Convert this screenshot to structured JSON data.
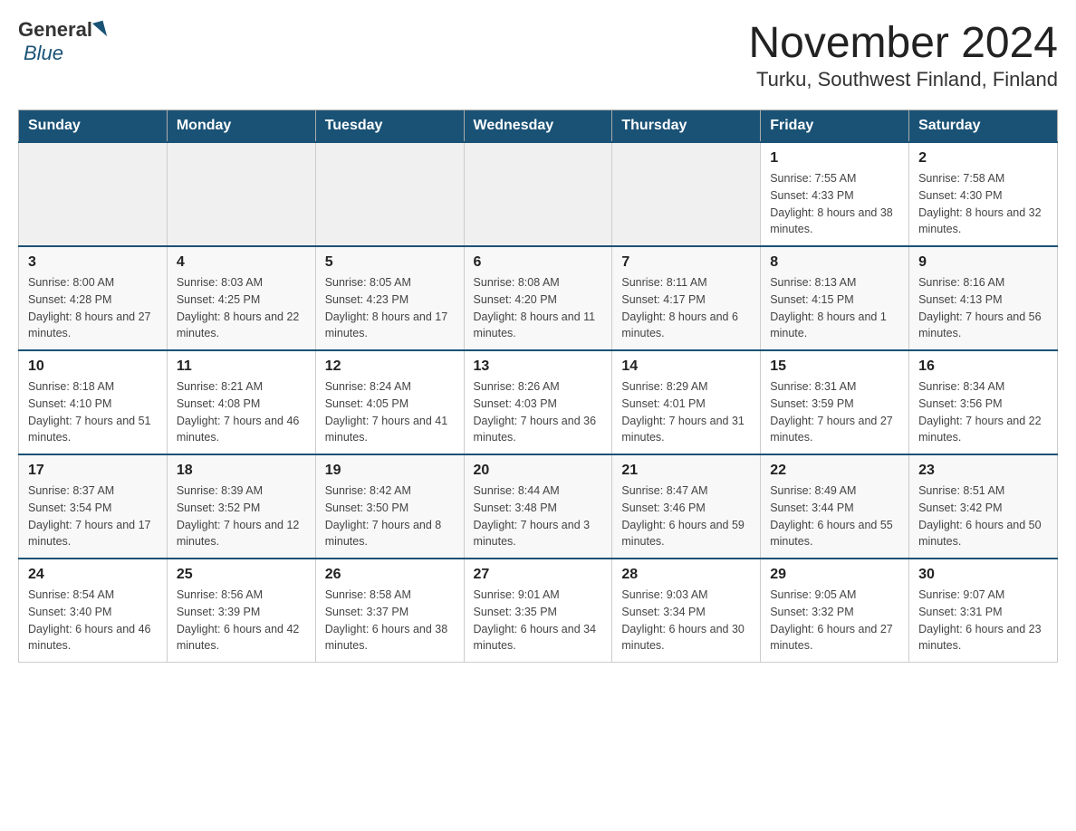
{
  "header": {
    "logo_general": "General",
    "logo_blue": "Blue",
    "title": "November 2024",
    "subtitle": "Turku, Southwest Finland, Finland"
  },
  "weekdays": [
    "Sunday",
    "Monday",
    "Tuesday",
    "Wednesday",
    "Thursday",
    "Friday",
    "Saturday"
  ],
  "weeks": [
    [
      {
        "day": "",
        "sunrise": "",
        "sunset": "",
        "daylight": ""
      },
      {
        "day": "",
        "sunrise": "",
        "sunset": "",
        "daylight": ""
      },
      {
        "day": "",
        "sunrise": "",
        "sunset": "",
        "daylight": ""
      },
      {
        "day": "",
        "sunrise": "",
        "sunset": "",
        "daylight": ""
      },
      {
        "day": "",
        "sunrise": "",
        "sunset": "",
        "daylight": ""
      },
      {
        "day": "1",
        "sunrise": "Sunrise: 7:55 AM",
        "sunset": "Sunset: 4:33 PM",
        "daylight": "Daylight: 8 hours and 38 minutes."
      },
      {
        "day": "2",
        "sunrise": "Sunrise: 7:58 AM",
        "sunset": "Sunset: 4:30 PM",
        "daylight": "Daylight: 8 hours and 32 minutes."
      }
    ],
    [
      {
        "day": "3",
        "sunrise": "Sunrise: 8:00 AM",
        "sunset": "Sunset: 4:28 PM",
        "daylight": "Daylight: 8 hours and 27 minutes."
      },
      {
        "day": "4",
        "sunrise": "Sunrise: 8:03 AM",
        "sunset": "Sunset: 4:25 PM",
        "daylight": "Daylight: 8 hours and 22 minutes."
      },
      {
        "day": "5",
        "sunrise": "Sunrise: 8:05 AM",
        "sunset": "Sunset: 4:23 PM",
        "daylight": "Daylight: 8 hours and 17 minutes."
      },
      {
        "day": "6",
        "sunrise": "Sunrise: 8:08 AM",
        "sunset": "Sunset: 4:20 PM",
        "daylight": "Daylight: 8 hours and 11 minutes."
      },
      {
        "day": "7",
        "sunrise": "Sunrise: 8:11 AM",
        "sunset": "Sunset: 4:17 PM",
        "daylight": "Daylight: 8 hours and 6 minutes."
      },
      {
        "day": "8",
        "sunrise": "Sunrise: 8:13 AM",
        "sunset": "Sunset: 4:15 PM",
        "daylight": "Daylight: 8 hours and 1 minute."
      },
      {
        "day": "9",
        "sunrise": "Sunrise: 8:16 AM",
        "sunset": "Sunset: 4:13 PM",
        "daylight": "Daylight: 7 hours and 56 minutes."
      }
    ],
    [
      {
        "day": "10",
        "sunrise": "Sunrise: 8:18 AM",
        "sunset": "Sunset: 4:10 PM",
        "daylight": "Daylight: 7 hours and 51 minutes."
      },
      {
        "day": "11",
        "sunrise": "Sunrise: 8:21 AM",
        "sunset": "Sunset: 4:08 PM",
        "daylight": "Daylight: 7 hours and 46 minutes."
      },
      {
        "day": "12",
        "sunrise": "Sunrise: 8:24 AM",
        "sunset": "Sunset: 4:05 PM",
        "daylight": "Daylight: 7 hours and 41 minutes."
      },
      {
        "day": "13",
        "sunrise": "Sunrise: 8:26 AM",
        "sunset": "Sunset: 4:03 PM",
        "daylight": "Daylight: 7 hours and 36 minutes."
      },
      {
        "day": "14",
        "sunrise": "Sunrise: 8:29 AM",
        "sunset": "Sunset: 4:01 PM",
        "daylight": "Daylight: 7 hours and 31 minutes."
      },
      {
        "day": "15",
        "sunrise": "Sunrise: 8:31 AM",
        "sunset": "Sunset: 3:59 PM",
        "daylight": "Daylight: 7 hours and 27 minutes."
      },
      {
        "day": "16",
        "sunrise": "Sunrise: 8:34 AM",
        "sunset": "Sunset: 3:56 PM",
        "daylight": "Daylight: 7 hours and 22 minutes."
      }
    ],
    [
      {
        "day": "17",
        "sunrise": "Sunrise: 8:37 AM",
        "sunset": "Sunset: 3:54 PM",
        "daylight": "Daylight: 7 hours and 17 minutes."
      },
      {
        "day": "18",
        "sunrise": "Sunrise: 8:39 AM",
        "sunset": "Sunset: 3:52 PM",
        "daylight": "Daylight: 7 hours and 12 minutes."
      },
      {
        "day": "19",
        "sunrise": "Sunrise: 8:42 AM",
        "sunset": "Sunset: 3:50 PM",
        "daylight": "Daylight: 7 hours and 8 minutes."
      },
      {
        "day": "20",
        "sunrise": "Sunrise: 8:44 AM",
        "sunset": "Sunset: 3:48 PM",
        "daylight": "Daylight: 7 hours and 3 minutes."
      },
      {
        "day": "21",
        "sunrise": "Sunrise: 8:47 AM",
        "sunset": "Sunset: 3:46 PM",
        "daylight": "Daylight: 6 hours and 59 minutes."
      },
      {
        "day": "22",
        "sunrise": "Sunrise: 8:49 AM",
        "sunset": "Sunset: 3:44 PM",
        "daylight": "Daylight: 6 hours and 55 minutes."
      },
      {
        "day": "23",
        "sunrise": "Sunrise: 8:51 AM",
        "sunset": "Sunset: 3:42 PM",
        "daylight": "Daylight: 6 hours and 50 minutes."
      }
    ],
    [
      {
        "day": "24",
        "sunrise": "Sunrise: 8:54 AM",
        "sunset": "Sunset: 3:40 PM",
        "daylight": "Daylight: 6 hours and 46 minutes."
      },
      {
        "day": "25",
        "sunrise": "Sunrise: 8:56 AM",
        "sunset": "Sunset: 3:39 PM",
        "daylight": "Daylight: 6 hours and 42 minutes."
      },
      {
        "day": "26",
        "sunrise": "Sunrise: 8:58 AM",
        "sunset": "Sunset: 3:37 PM",
        "daylight": "Daylight: 6 hours and 38 minutes."
      },
      {
        "day": "27",
        "sunrise": "Sunrise: 9:01 AM",
        "sunset": "Sunset: 3:35 PM",
        "daylight": "Daylight: 6 hours and 34 minutes."
      },
      {
        "day": "28",
        "sunrise": "Sunrise: 9:03 AM",
        "sunset": "Sunset: 3:34 PM",
        "daylight": "Daylight: 6 hours and 30 minutes."
      },
      {
        "day": "29",
        "sunrise": "Sunrise: 9:05 AM",
        "sunset": "Sunset: 3:32 PM",
        "daylight": "Daylight: 6 hours and 27 minutes."
      },
      {
        "day": "30",
        "sunrise": "Sunrise: 9:07 AM",
        "sunset": "Sunset: 3:31 PM",
        "daylight": "Daylight: 6 hours and 23 minutes."
      }
    ]
  ]
}
